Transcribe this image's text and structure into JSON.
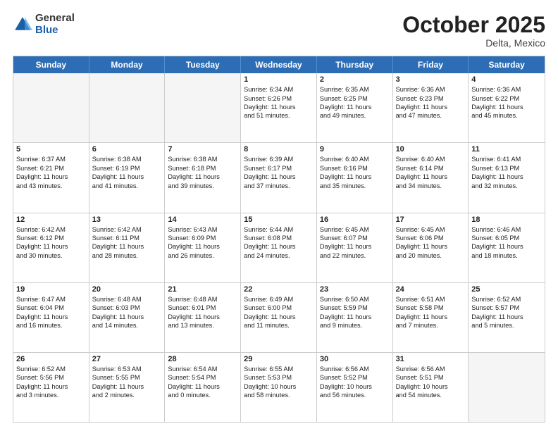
{
  "header": {
    "logo": {
      "general": "General",
      "blue": "Blue"
    },
    "title": "October 2025",
    "location": "Delta, Mexico"
  },
  "days_of_week": [
    "Sunday",
    "Monday",
    "Tuesday",
    "Wednesday",
    "Thursday",
    "Friday",
    "Saturday"
  ],
  "weeks": [
    [
      {
        "day": "",
        "empty": true
      },
      {
        "day": "",
        "empty": true
      },
      {
        "day": "",
        "empty": true
      },
      {
        "day": "1",
        "lines": [
          "Sunrise: 6:34 AM",
          "Sunset: 6:26 PM",
          "Daylight: 11 hours",
          "and 51 minutes."
        ]
      },
      {
        "day": "2",
        "lines": [
          "Sunrise: 6:35 AM",
          "Sunset: 6:25 PM",
          "Daylight: 11 hours",
          "and 49 minutes."
        ]
      },
      {
        "day": "3",
        "lines": [
          "Sunrise: 6:36 AM",
          "Sunset: 6:23 PM",
          "Daylight: 11 hours",
          "and 47 minutes."
        ]
      },
      {
        "day": "4",
        "lines": [
          "Sunrise: 6:36 AM",
          "Sunset: 6:22 PM",
          "Daylight: 11 hours",
          "and 45 minutes."
        ]
      }
    ],
    [
      {
        "day": "5",
        "lines": [
          "Sunrise: 6:37 AM",
          "Sunset: 6:21 PM",
          "Daylight: 11 hours",
          "and 43 minutes."
        ]
      },
      {
        "day": "6",
        "lines": [
          "Sunrise: 6:38 AM",
          "Sunset: 6:19 PM",
          "Daylight: 11 hours",
          "and 41 minutes."
        ]
      },
      {
        "day": "7",
        "lines": [
          "Sunrise: 6:38 AM",
          "Sunset: 6:18 PM",
          "Daylight: 11 hours",
          "and 39 minutes."
        ]
      },
      {
        "day": "8",
        "lines": [
          "Sunrise: 6:39 AM",
          "Sunset: 6:17 PM",
          "Daylight: 11 hours",
          "and 37 minutes."
        ]
      },
      {
        "day": "9",
        "lines": [
          "Sunrise: 6:40 AM",
          "Sunset: 6:16 PM",
          "Daylight: 11 hours",
          "and 35 minutes."
        ]
      },
      {
        "day": "10",
        "lines": [
          "Sunrise: 6:40 AM",
          "Sunset: 6:14 PM",
          "Daylight: 11 hours",
          "and 34 minutes."
        ]
      },
      {
        "day": "11",
        "lines": [
          "Sunrise: 6:41 AM",
          "Sunset: 6:13 PM",
          "Daylight: 11 hours",
          "and 32 minutes."
        ]
      }
    ],
    [
      {
        "day": "12",
        "lines": [
          "Sunrise: 6:42 AM",
          "Sunset: 6:12 PM",
          "Daylight: 11 hours",
          "and 30 minutes."
        ]
      },
      {
        "day": "13",
        "lines": [
          "Sunrise: 6:42 AM",
          "Sunset: 6:11 PM",
          "Daylight: 11 hours",
          "and 28 minutes."
        ]
      },
      {
        "day": "14",
        "lines": [
          "Sunrise: 6:43 AM",
          "Sunset: 6:09 PM",
          "Daylight: 11 hours",
          "and 26 minutes."
        ]
      },
      {
        "day": "15",
        "lines": [
          "Sunrise: 6:44 AM",
          "Sunset: 6:08 PM",
          "Daylight: 11 hours",
          "and 24 minutes."
        ]
      },
      {
        "day": "16",
        "lines": [
          "Sunrise: 6:45 AM",
          "Sunset: 6:07 PM",
          "Daylight: 11 hours",
          "and 22 minutes."
        ]
      },
      {
        "day": "17",
        "lines": [
          "Sunrise: 6:45 AM",
          "Sunset: 6:06 PM",
          "Daylight: 11 hours",
          "and 20 minutes."
        ]
      },
      {
        "day": "18",
        "lines": [
          "Sunrise: 6:46 AM",
          "Sunset: 6:05 PM",
          "Daylight: 11 hours",
          "and 18 minutes."
        ]
      }
    ],
    [
      {
        "day": "19",
        "lines": [
          "Sunrise: 6:47 AM",
          "Sunset: 6:04 PM",
          "Daylight: 11 hours",
          "and 16 minutes."
        ]
      },
      {
        "day": "20",
        "lines": [
          "Sunrise: 6:48 AM",
          "Sunset: 6:03 PM",
          "Daylight: 11 hours",
          "and 14 minutes."
        ]
      },
      {
        "day": "21",
        "lines": [
          "Sunrise: 6:48 AM",
          "Sunset: 6:01 PM",
          "Daylight: 11 hours",
          "and 13 minutes."
        ]
      },
      {
        "day": "22",
        "lines": [
          "Sunrise: 6:49 AM",
          "Sunset: 6:00 PM",
          "Daylight: 11 hours",
          "and 11 minutes."
        ]
      },
      {
        "day": "23",
        "lines": [
          "Sunrise: 6:50 AM",
          "Sunset: 5:59 PM",
          "Daylight: 11 hours",
          "and 9 minutes."
        ]
      },
      {
        "day": "24",
        "lines": [
          "Sunrise: 6:51 AM",
          "Sunset: 5:58 PM",
          "Daylight: 11 hours",
          "and 7 minutes."
        ]
      },
      {
        "day": "25",
        "lines": [
          "Sunrise: 6:52 AM",
          "Sunset: 5:57 PM",
          "Daylight: 11 hours",
          "and 5 minutes."
        ]
      }
    ],
    [
      {
        "day": "26",
        "lines": [
          "Sunrise: 6:52 AM",
          "Sunset: 5:56 PM",
          "Daylight: 11 hours",
          "and 3 minutes."
        ]
      },
      {
        "day": "27",
        "lines": [
          "Sunrise: 6:53 AM",
          "Sunset: 5:55 PM",
          "Daylight: 11 hours",
          "and 2 minutes."
        ]
      },
      {
        "day": "28",
        "lines": [
          "Sunrise: 6:54 AM",
          "Sunset: 5:54 PM",
          "Daylight: 11 hours",
          "and 0 minutes."
        ]
      },
      {
        "day": "29",
        "lines": [
          "Sunrise: 6:55 AM",
          "Sunset: 5:53 PM",
          "Daylight: 10 hours",
          "and 58 minutes."
        ]
      },
      {
        "day": "30",
        "lines": [
          "Sunrise: 6:56 AM",
          "Sunset: 5:52 PM",
          "Daylight: 10 hours",
          "and 56 minutes."
        ]
      },
      {
        "day": "31",
        "lines": [
          "Sunrise: 6:56 AM",
          "Sunset: 5:51 PM",
          "Daylight: 10 hours",
          "and 54 minutes."
        ]
      },
      {
        "day": "",
        "empty": true
      }
    ]
  ]
}
